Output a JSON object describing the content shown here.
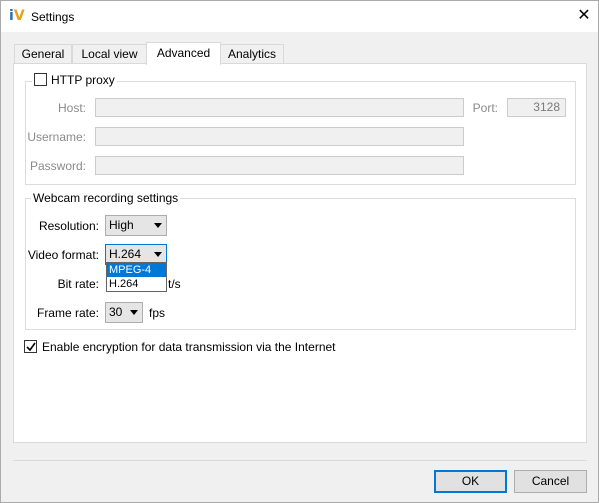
{
  "window": {
    "title": "Settings",
    "icon": "iv-logo-icon",
    "logo_text": "iV"
  },
  "tabs": [
    {
      "label": "General",
      "active": false
    },
    {
      "label": "Local view",
      "active": false
    },
    {
      "label": "Advanced",
      "active": true
    },
    {
      "label": "Analytics",
      "active": false
    }
  ],
  "proxy": {
    "checkbox_label": "HTTP proxy",
    "checked": false,
    "host_label": "Host:",
    "host_value": "",
    "port_label": "Port:",
    "port_value": "3128",
    "username_label": "Username:",
    "username_value": "",
    "password_label": "Password:",
    "password_value": ""
  },
  "webcam": {
    "title": "Webcam recording settings",
    "resolution_label": "Resolution:",
    "resolution_value": "High",
    "video_format_label": "Video format:",
    "video_format_value": "H.264",
    "video_format_options": [
      "MPEG-4",
      "H.264"
    ],
    "video_format_highlighted": "MPEG-4",
    "bitrate_label": "Bit rate:",
    "bitrate_unit_visible": "t/s",
    "framerate_label": "Frame rate:",
    "framerate_value": "30",
    "framerate_unit": "fps"
  },
  "encryption": {
    "label": "Enable encryption for data transmission via the Internet",
    "checked": true
  },
  "buttons": {
    "ok": "OK",
    "cancel": "Cancel"
  },
  "colors": {
    "accent": "#0078d7",
    "logo_blue": "#2a6ebb",
    "logo_orange": "#e9a21c"
  }
}
